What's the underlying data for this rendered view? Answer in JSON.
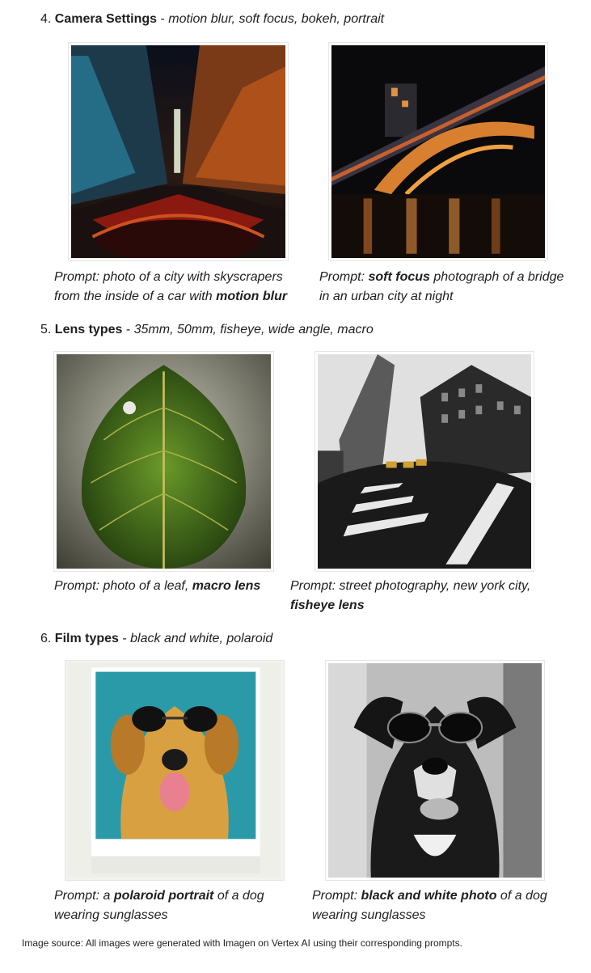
{
  "sections": [
    {
      "number": "4.",
      "title": "Camera Settings",
      "separator": " - ",
      "subtitle": "motion blur, soft focus, bokeh, portrait",
      "items": [
        {
          "image": "city-motion-blur-photo",
          "caption_pre": "Prompt: photo of a city with skyscrapers from the inside of a car with ",
          "caption_bold": "motion blur",
          "caption_post": ""
        },
        {
          "image": "bridge-soft-focus-photo",
          "caption_pre": "Prompt: ",
          "caption_bold": "soft focus",
          "caption_post": " photograph of a bridge in an urban city at night"
        }
      ]
    },
    {
      "number": "5.",
      "title": "Lens types",
      "separator": " - ",
      "subtitle": "35mm, 50mm, fisheye, wide angle, macro",
      "items": [
        {
          "image": "leaf-macro-photo",
          "caption_pre": "Prompt: photo of a leaf, ",
          "caption_bold": "macro lens",
          "caption_post": ""
        },
        {
          "image": "street-fisheye-photo",
          "caption_pre": "Prompt: street photography, new york city, ",
          "caption_bold": "fisheye lens",
          "caption_post": ""
        }
      ]
    },
    {
      "number": "6.",
      "title": "Film types",
      "separator": " - ",
      "subtitle": "black and white, polaroid",
      "items": [
        {
          "image": "dog-polaroid-photo",
          "caption_pre": "Prompt: a ",
          "caption_bold": "polaroid portrait",
          "caption_post": " of a dog wearing sunglasses"
        },
        {
          "image": "dog-black-white-photo",
          "caption_pre": "Prompt: ",
          "caption_bold": "black and white photo",
          "caption_post": " of a dog wearing sunglasses"
        }
      ]
    }
  ],
  "footer": {
    "source": "Image source: All images were generated with Imagen on Vertex AI using their corresponding prompts."
  }
}
